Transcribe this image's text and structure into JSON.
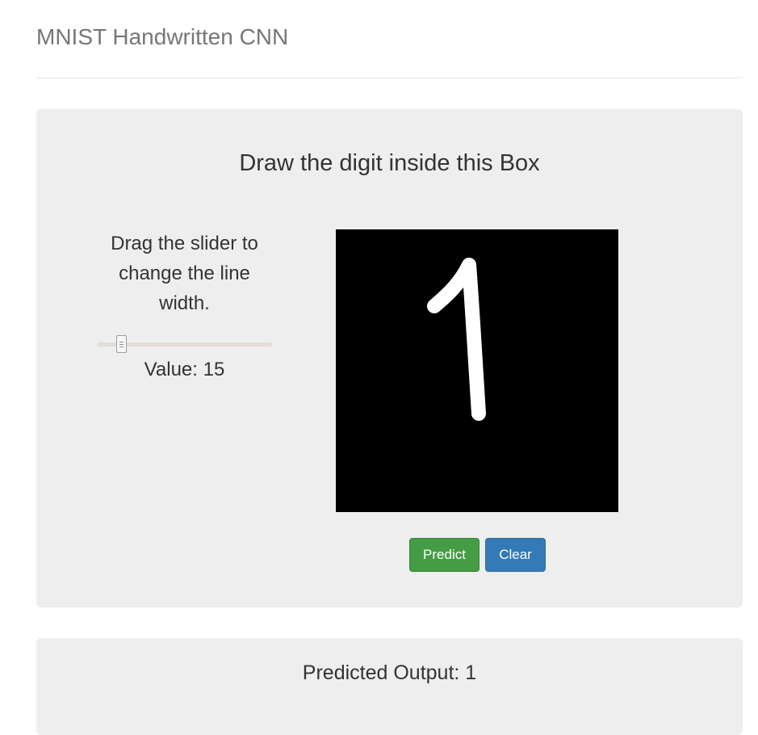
{
  "header": {
    "title": "MNIST Handwritten CNN"
  },
  "draw_panel": {
    "title": "Draw the digit inside this Box",
    "slider_instructions": "Drag the slider to change the line width.",
    "slider_value_label": "Value: 15",
    "slider_value": 15,
    "canvas": {
      "background_color": "#000000",
      "stroke_color": "#ffffff",
      "drawn_digit": "1"
    },
    "predict_button": {
      "label": "Predict",
      "color": "#449d44"
    },
    "clear_button": {
      "label": "Clear",
      "color": "#337ab7"
    }
  },
  "output_panel": {
    "text": "Predicted Output: 1"
  }
}
